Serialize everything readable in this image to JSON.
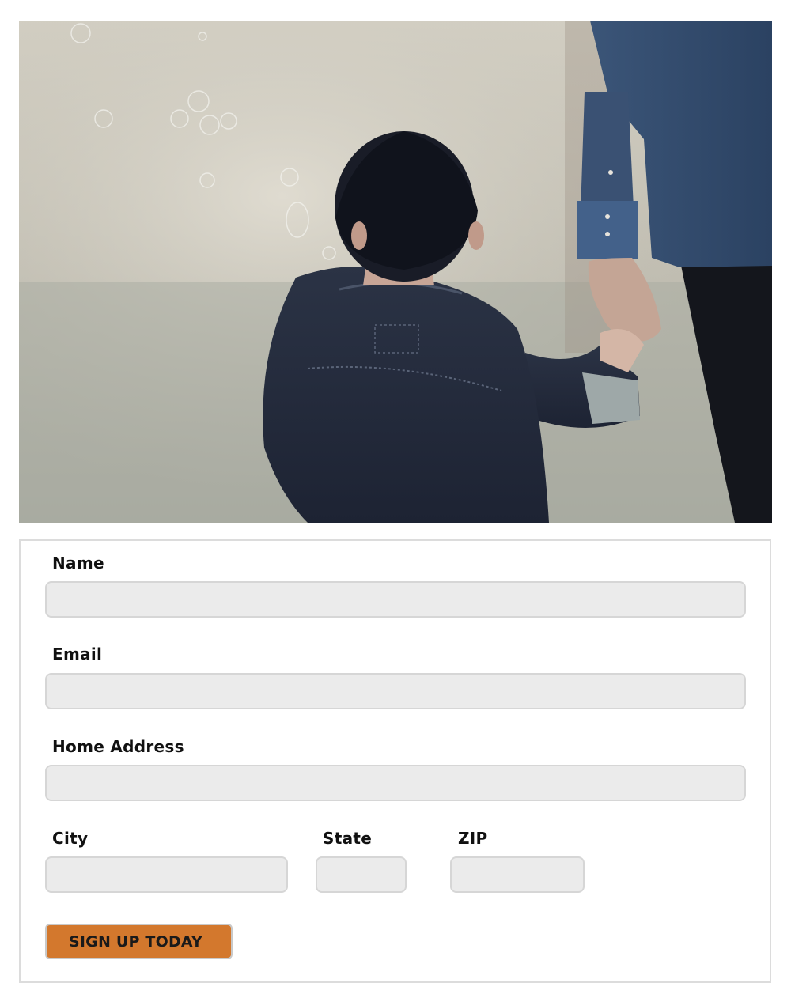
{
  "form": {
    "name": {
      "label": "Name",
      "value": ""
    },
    "email": {
      "label": "Email",
      "value": ""
    },
    "home_address": {
      "label": "Home Address",
      "value": ""
    },
    "city": {
      "label": "City",
      "value": ""
    },
    "state": {
      "label": "State",
      "value": ""
    },
    "zip": {
      "label": "ZIP",
      "value": ""
    },
    "submit_label": "SIGN UP TODAY"
  },
  "colors": {
    "accent": "#d3782d",
    "field_bg": "#ebebeb",
    "field_border": "#d6d6d6",
    "card_border": "#dcdcdc"
  }
}
